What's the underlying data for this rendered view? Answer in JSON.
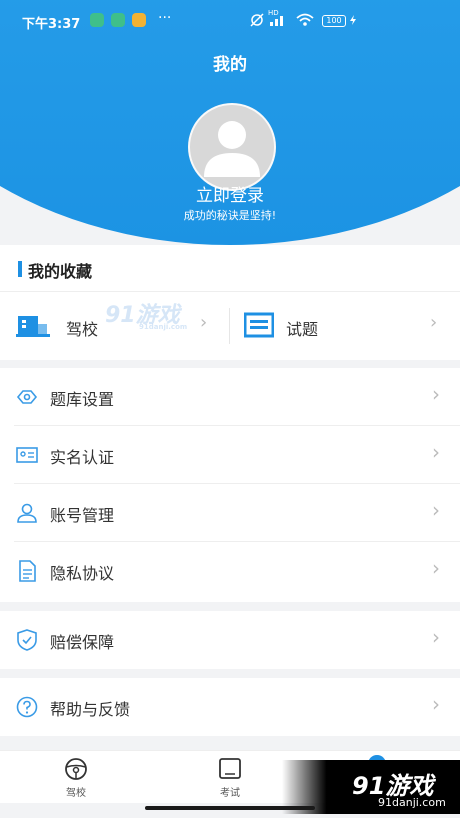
{
  "status_bar": {
    "time": "下午3:37",
    "dots": "···",
    "network": "HD",
    "battery": "100"
  },
  "header": {
    "title": "我的",
    "login": "立即登录",
    "slogan": "成功的秘诀是坚持!"
  },
  "favorites": {
    "title": "我的收藏",
    "items": [
      {
        "label": "驾校",
        "icon": "school-icon"
      },
      {
        "label": "试题",
        "icon": "questions-icon"
      }
    ]
  },
  "menu": [
    {
      "label": "题库设置",
      "icon": "question-bank-icon"
    },
    {
      "label": "实名认证",
      "icon": "id-card-icon"
    },
    {
      "label": "账号管理",
      "icon": "user-icon"
    },
    {
      "label": "隐私协议",
      "icon": "document-icon"
    },
    {
      "label": "赔偿保障",
      "icon": "shield-icon"
    },
    {
      "label": "帮助与反馈",
      "icon": "help-icon"
    }
  ],
  "bottom_nav": [
    {
      "label": "驾校",
      "icon": "steering-wheel-icon"
    },
    {
      "label": "考试",
      "icon": "exam-icon"
    }
  ],
  "watermark": {
    "text": "91游戏",
    "site": "91danji.com",
    "text_small": "91游戏",
    "site_small": "91danji.com"
  },
  "colors": {
    "primary": "#1e90e3",
    "background": "#f2f3f5"
  }
}
